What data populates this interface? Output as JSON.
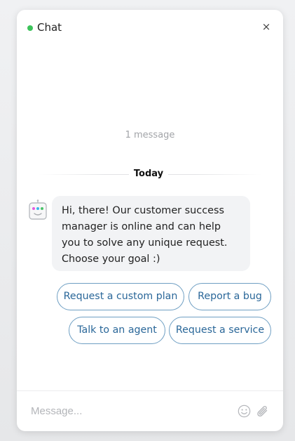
{
  "header": {
    "title": "Chat",
    "close_label": "×",
    "status_color": "#3cc35a"
  },
  "conversation": {
    "message_count": "1 message",
    "day_label": "Today",
    "bot_message": "Hi, there! Our customer success manager is online and can help you to solve any unique request. Choose your goal :)"
  },
  "quick_replies": [
    {
      "label": "Request a custom plan"
    },
    {
      "label": "Report a bug"
    },
    {
      "label": "Talk to an agent"
    },
    {
      "label": "Request a service"
    }
  ],
  "composer": {
    "placeholder": "Message...",
    "emoji_icon": "smiley-icon",
    "attach_icon": "paperclip-icon"
  },
  "colors": {
    "accent": "#2a6799",
    "reply_border": "#6f9fc3",
    "bubble_bg": "#f2f3f5"
  }
}
